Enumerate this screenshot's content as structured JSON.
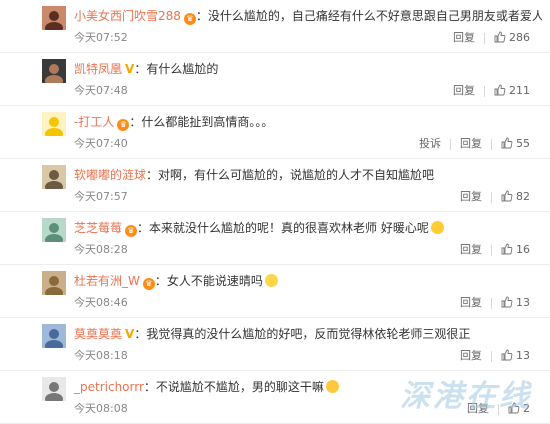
{
  "comments": [
    {
      "user": "小美女西门吹雪288",
      "badge": "vip",
      "text": "：没什么尴尬的，自己痛经有什么不好意思跟自己男朋友或者爱人说的。",
      "time": "今天07:52",
      "reply": "回复",
      "likes": "286",
      "report": "",
      "emoji": ""
    },
    {
      "user": "凯特凤凰",
      "badge": "v",
      "text": "：有什么尴尬的",
      "time": "今天07:48",
      "reply": "回复",
      "likes": "211",
      "report": "",
      "emoji": ""
    },
    {
      "user": "-打工人",
      "badge": "vip",
      "text": "：什么都能扯到高情商。。。",
      "time": "今天07:40",
      "reply": "回复",
      "likes": "55",
      "report": "投诉",
      "emoji": ""
    },
    {
      "user": "软嘟嘟的涟球",
      "badge": "",
      "text": "：对啊，有什么可尴尬的，说尴尬的人才不自知尴尬吧",
      "time": "今天07:57",
      "reply": "回复",
      "likes": "82",
      "report": "",
      "emoji": ""
    },
    {
      "user": "芝芝莓莓",
      "badge": "vip",
      "text": "：本来就没什么尴尬的呢！真的很喜欢林老师 好暖心呢",
      "time": "今天08:28",
      "reply": "回复",
      "likes": "16",
      "report": "",
      "emoji": "heart-eyes"
    },
    {
      "user": "杜若有洲_W",
      "badge": "vip",
      "text": "：女人不能说速晴吗",
      "time": "今天08:46",
      "reply": "回复",
      "likes": "13",
      "report": "",
      "emoji": "sweat"
    },
    {
      "user": "莫奠莫奠",
      "badge": "v",
      "text": "：我觉得真的没什么尴尬的好吧，反而觉得林依轮老师三观很正",
      "time": "今天08:18",
      "reply": "回复",
      "likes": "13",
      "report": "",
      "emoji": ""
    },
    {
      "user": "_petrichorrr",
      "badge": "",
      "text": "：不说尴尬不尴尬，男的聊这干嘛",
      "time": "今天08:08",
      "reply": "回复",
      "likes": "2",
      "report": "",
      "emoji": "smirk"
    }
  ],
  "watermark": "深港在线",
  "colors": {
    "username": "#eb7350",
    "vip_badge": "#ff8c16",
    "v_badge": "#f7a600",
    "meta": "#888888",
    "divider": "#eeeeee"
  },
  "icons": {
    "like": "thumbs-up-icon",
    "vip": "vip-member-icon",
    "verified": "verified-v-icon"
  }
}
